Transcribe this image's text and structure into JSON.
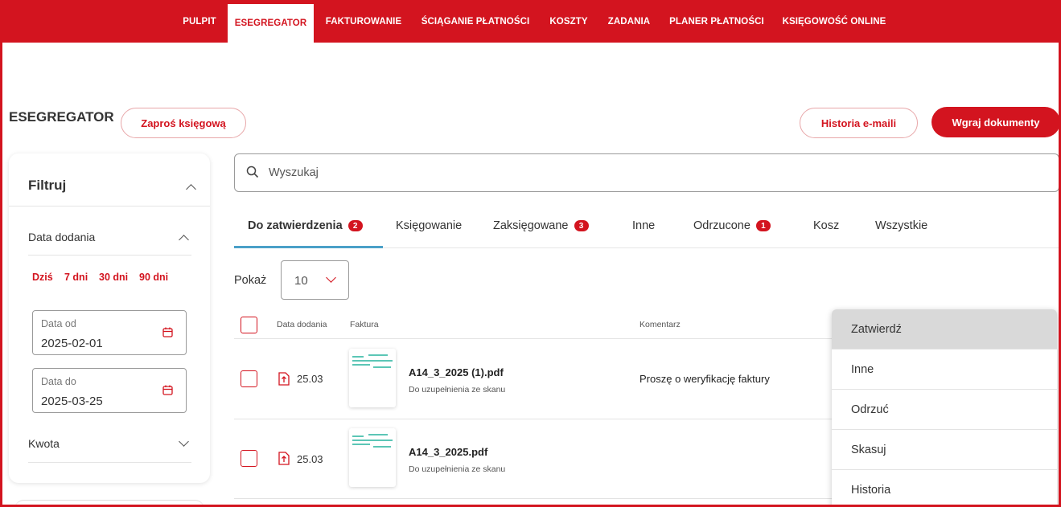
{
  "nav": {
    "items": [
      "PULPIT",
      "ESEGREGATOR",
      "FAKTUROWANIE",
      "ŚCIĄGANIE PŁATNOŚCI",
      "KOSZTY",
      "ZADANIA",
      "PLANER PŁATNOŚCI",
      "KSIĘGOWOŚĆ ONLINE"
    ],
    "active": "ESEGREGATOR"
  },
  "header": {
    "title": "ESEGREGATOR",
    "invite_button": "Zaproś księgową",
    "history_button": "Historia e-maili",
    "upload_button": "Wgraj dokumenty"
  },
  "filters": {
    "title": "Filtruj",
    "date_section": "Data dodania",
    "quick": [
      "Dziś",
      "7 dni",
      "30 dni",
      "90 dni"
    ],
    "date_from_label": "Data od",
    "date_from_value": "2025-02-01",
    "date_to_label": "Data do",
    "date_to_value": "2025-03-25",
    "amount_section": "Kwota"
  },
  "search": {
    "placeholder": "Wyszukaj"
  },
  "tabs": [
    {
      "label": "Do zatwierdzenia",
      "badge": "2"
    },
    {
      "label": "Księgowanie",
      "badge": ""
    },
    {
      "label": "Zaksięgowane",
      "badge": "3"
    },
    {
      "label": "Inne",
      "badge": ""
    },
    {
      "label": "Odrzucone",
      "badge": "1"
    },
    {
      "label": "Kosz",
      "badge": ""
    },
    {
      "label": "Wszystkie",
      "badge": ""
    }
  ],
  "pager": {
    "label": "Pokaż",
    "value": "10"
  },
  "table": {
    "columns": [
      "Data dodania",
      "Faktura",
      "Komentarz"
    ],
    "rows": [
      {
        "date": "25.03",
        "file": "A14_3_2025 (1).pdf",
        "status": "Do uzupełnienia ze skanu",
        "comment": "Proszę o weryfikację faktury"
      },
      {
        "date": "25.03",
        "file": "A14_3_2025.pdf",
        "status": "Do uzupełnienia ze skanu",
        "comment": ""
      }
    ]
  },
  "menu": {
    "items": [
      "Zatwierdź",
      "Inne",
      "Odrzuć",
      "Skasuj",
      "Historia"
    ]
  },
  "colors": {
    "brand": "#d3141f",
    "tab_underline": "#4aa0c8",
    "thumb_lines": "#5cc6b6"
  }
}
